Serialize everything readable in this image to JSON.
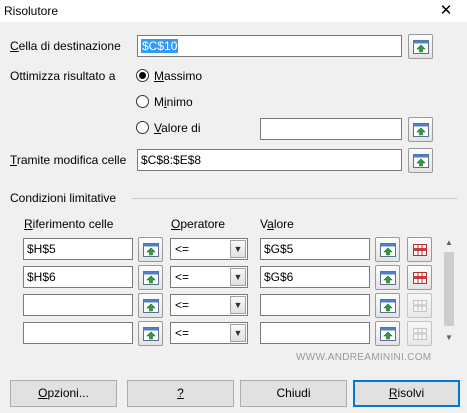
{
  "window": {
    "title": "Risolutore"
  },
  "target": {
    "label": "Cella di destinazione",
    "value": "$C$10"
  },
  "optimize": {
    "label": "Ottimizza risultato a",
    "options": [
      {
        "label": "Massimo",
        "selected": true
      },
      {
        "label": "Minimo",
        "selected": false
      },
      {
        "label": "Valore di",
        "selected": false
      }
    ],
    "value_field": ""
  },
  "changing_cells": {
    "label": "Tramite modifica celle",
    "value": "$C$8:$E$8"
  },
  "constraints": {
    "section_label": "Condizioni limitative",
    "col_ref": "Riferimento celle",
    "col_op": "Operatore",
    "col_val": "Valore",
    "rows": [
      {
        "ref": "$H$5",
        "op": "<=",
        "val": "$G$5"
      },
      {
        "ref": "$H$6",
        "op": "<=",
        "val": "$G$6"
      },
      {
        "ref": "",
        "op": "<=",
        "val": ""
      },
      {
        "ref": "",
        "op": "<=",
        "val": ""
      }
    ]
  },
  "watermark": "WWW.ANDREAMININI.COM",
  "buttons": {
    "options": "Opzioni...",
    "help": "?",
    "close": "Chiudi",
    "solve": "Risolvi"
  },
  "icons": {
    "picker": "shrink-dialog-icon",
    "delete": "delete-row-icon",
    "close": "close-icon"
  },
  "colors": {
    "selection": "#3399ff",
    "default_button_border": "#0078d7"
  }
}
